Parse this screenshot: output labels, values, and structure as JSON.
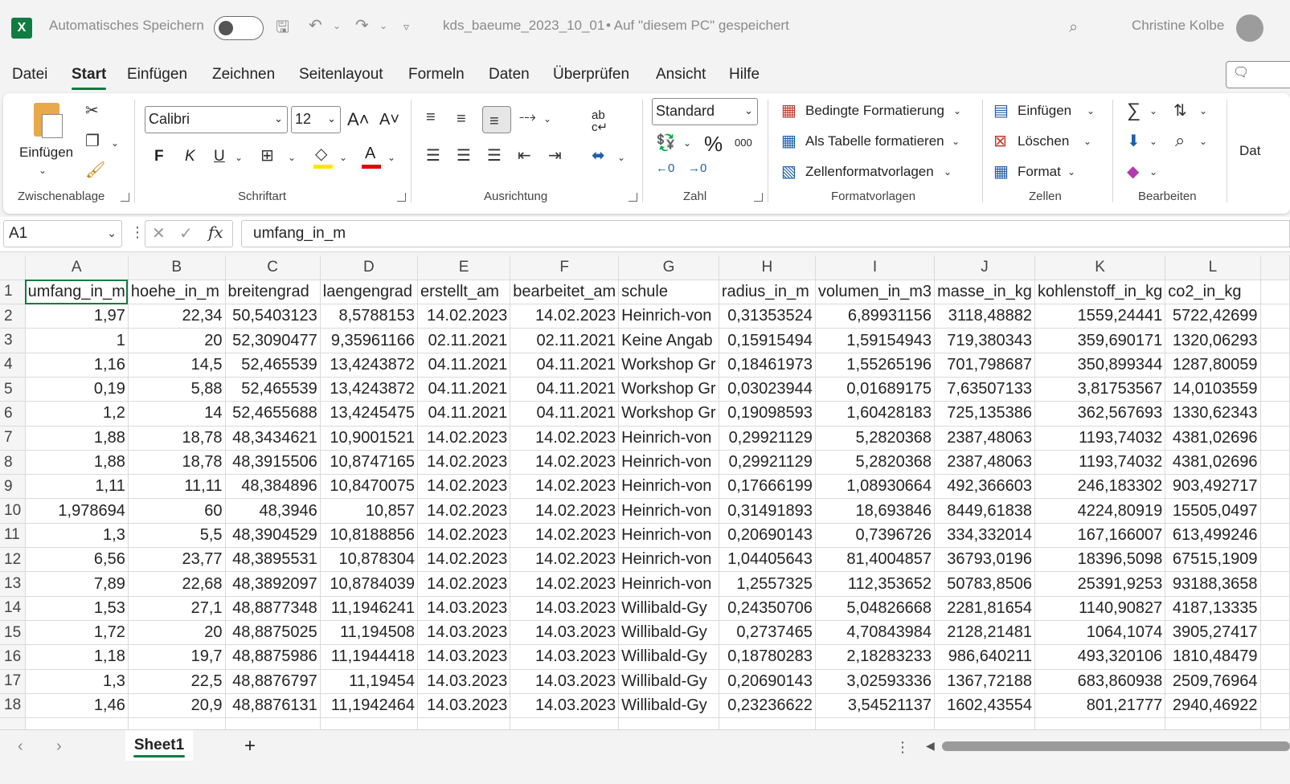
{
  "titlebar": {
    "autosave_label": "Automatisches Speichern",
    "filename": "kds_baeume_2023_10_01",
    "save_status": "• Auf \"diesem PC\" gespeichert",
    "user": "Christine Kolbe"
  },
  "menu": [
    "Datei",
    "Start",
    "Einfügen",
    "Zeichnen",
    "Seitenlayout",
    "Formeln",
    "Daten",
    "Überprüfen",
    "Ansicht",
    "Hilfe"
  ],
  "ribbon": {
    "clipboard": {
      "paste": "Einfügen",
      "label": "Zwischenablage"
    },
    "font": {
      "name": "Calibri",
      "size": "12",
      "bold": "F",
      "italic": "K",
      "underline": "U",
      "label": "Schriftart"
    },
    "alignment": {
      "label": "Ausrichtung"
    },
    "number": {
      "format": "Standard",
      "percent": "%",
      "thousands": "000",
      "label": "Zahl"
    },
    "styles": {
      "conditional": "Bedingte Formatierung",
      "as_table": "Als Tabelle formatieren",
      "cell_styles": "Zellenformatvorlagen",
      "label": "Formatvorlagen"
    },
    "cells": {
      "insert": "Einfügen",
      "delete": "Löschen",
      "format": "Format",
      "label": "Zellen"
    },
    "editing": {
      "label": "Bearbeiten"
    },
    "cut_off": "Dat"
  },
  "formula_bar": {
    "name_box": "A1",
    "fx": "fx",
    "content": "umfang_in_m"
  },
  "grid": {
    "columns": [
      "A",
      "B",
      "C",
      "D",
      "E",
      "F",
      "G",
      "H",
      "I",
      "J",
      "K",
      "L"
    ],
    "header_row": [
      "umfang_in_m",
      "hoehe_in_m",
      "breitengrad",
      "laengengrad",
      "erstellt_am",
      "bearbeitet_am",
      "schule",
      "radius_in_m",
      "volumen_in_m3",
      "masse_in_kg",
      "kohlenstoff_in_kg",
      "co2_in_kg"
    ],
    "rows": [
      [
        "1,97",
        "22,34",
        "50,5403123",
        "8,5788153",
        "14.02.2023",
        "14.02.2023",
        "Heinrich-von",
        "0,31353524",
        "6,89931156",
        "3118,48882",
        "1559,24441",
        "5722,42699"
      ],
      [
        "1",
        "20",
        "52,3090477",
        "9,35961166",
        "02.11.2021",
        "02.11.2021",
        "Keine Angab",
        "0,15915494",
        "1,59154943",
        "719,380343",
        "359,690171",
        "1320,06293"
      ],
      [
        "1,16",
        "14,5",
        "52,465539",
        "13,4243872",
        "04.11.2021",
        "04.11.2021",
        "Workshop Gr",
        "0,18461973",
        "1,55265196",
        "701,798687",
        "350,899344",
        "1287,80059"
      ],
      [
        "0,19",
        "5,88",
        "52,465539",
        "13,4243872",
        "04.11.2021",
        "04.11.2021",
        "Workshop Gr",
        "0,03023944",
        "0,01689175",
        "7,63507133",
        "3,81753567",
        "14,0103559"
      ],
      [
        "1,2",
        "14",
        "52,4655688",
        "13,4245475",
        "04.11.2021",
        "04.11.2021",
        "Workshop Gr",
        "0,19098593",
        "1,60428183",
        "725,135386",
        "362,567693",
        "1330,62343"
      ],
      [
        "1,88",
        "18,78",
        "48,3434621",
        "10,9001521",
        "14.02.2023",
        "14.02.2023",
        "Heinrich-von",
        "0,29921129",
        "5,2820368",
        "2387,48063",
        "1193,74032",
        "4381,02696"
      ],
      [
        "1,88",
        "18,78",
        "48,3915506",
        "10,8747165",
        "14.02.2023",
        "14.02.2023",
        "Heinrich-von",
        "0,29921129",
        "5,2820368",
        "2387,48063",
        "1193,74032",
        "4381,02696"
      ],
      [
        "1,11",
        "11,11",
        "48,384896",
        "10,8470075",
        "14.02.2023",
        "14.02.2023",
        "Heinrich-von",
        "0,17666199",
        "1,08930664",
        "492,366603",
        "246,183302",
        "903,492717"
      ],
      [
        "1,978694",
        "60",
        "48,3946",
        "10,857",
        "14.02.2023",
        "14.02.2023",
        "Heinrich-von",
        "0,31491893",
        "18,693846",
        "8449,61838",
        "4224,80919",
        "15505,0497"
      ],
      [
        "1,3",
        "5,5",
        "48,3904529",
        "10,8188856",
        "14.02.2023",
        "14.02.2023",
        "Heinrich-von",
        "0,20690143",
        "0,7396726",
        "334,332014",
        "167,166007",
        "613,499246"
      ],
      [
        "6,56",
        "23,77",
        "48,3895531",
        "10,878304",
        "14.02.2023",
        "14.02.2023",
        "Heinrich-von",
        "1,04405643",
        "81,4004857",
        "36793,0196",
        "18396,5098",
        "67515,1909"
      ],
      [
        "7,89",
        "22,68",
        "48,3892097",
        "10,8784039",
        "14.02.2023",
        "14.02.2023",
        "Heinrich-von",
        "1,2557325",
        "112,353652",
        "50783,8506",
        "25391,9253",
        "93188,3658"
      ],
      [
        "1,53",
        "27,1",
        "48,8877348",
        "11,1946241",
        "14.03.2023",
        "14.03.2023",
        "Willibald-Gy",
        "0,24350706",
        "5,04826668",
        "2281,81654",
        "1140,90827",
        "4187,13335"
      ],
      [
        "1,72",
        "20",
        "48,8875025",
        "11,194508",
        "14.03.2023",
        "14.03.2023",
        "Willibald-Gy",
        "0,2737465",
        "4,70843984",
        "2128,21481",
        "1064,1074",
        "3905,27417"
      ],
      [
        "1,18",
        "19,7",
        "48,8875986",
        "11,1944418",
        "14.03.2023",
        "14.03.2023",
        "Willibald-Gy",
        "0,18780283",
        "2,18283233",
        "986,640211",
        "493,320106",
        "1810,48479"
      ],
      [
        "1,3",
        "22,5",
        "48,8876797",
        "11,19454",
        "14.03.2023",
        "14.03.2023",
        "Willibald-Gy",
        "0,20690143",
        "3,02593336",
        "1367,72188",
        "683,860938",
        "2509,76964"
      ],
      [
        "1,46",
        "20,9",
        "48,8876131",
        "11,1942464",
        "14.03.2023",
        "14.03.2023",
        "Willibald-Gy",
        "0,23236622",
        "3,54521137",
        "1602,43554",
        "801,21777",
        "2940,46922"
      ]
    ]
  },
  "sheets": [
    "Sheet1"
  ],
  "add_sheet": "+"
}
